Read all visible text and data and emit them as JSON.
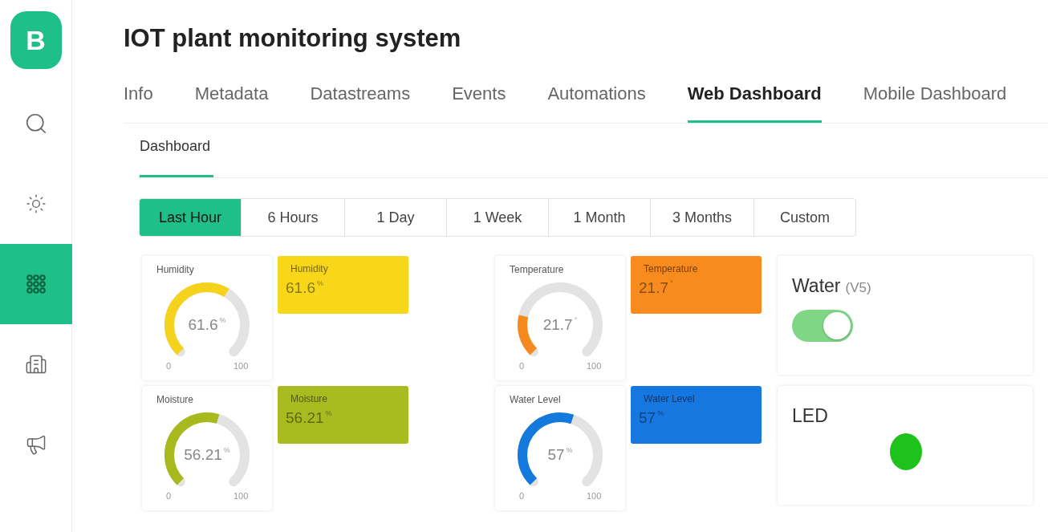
{
  "sidebar": {
    "logo": "B",
    "items": [
      {
        "selected": false
      },
      {
        "selected": false
      },
      {
        "selected": true
      },
      {
        "selected": false
      },
      {
        "selected": false
      }
    ]
  },
  "title": "IOT plant monitoring system",
  "tabs": [
    {
      "label": "Info",
      "selected": false
    },
    {
      "label": "Metadata",
      "selected": false
    },
    {
      "label": "Datastreams",
      "selected": false
    },
    {
      "label": "Events",
      "selected": false
    },
    {
      "label": "Automations",
      "selected": false
    },
    {
      "label": "Web Dashboard",
      "selected": true
    },
    {
      "label": "Mobile Dashboard",
      "selected": false
    }
  ],
  "subtabs": [
    {
      "label": "Dashboard",
      "selected": true
    }
  ],
  "time_ranges": [
    {
      "label": "Last Hour",
      "selected": true
    },
    {
      "label": "6 Hours",
      "selected": false
    },
    {
      "label": "1 Day",
      "selected": false
    },
    {
      "label": "1 Week",
      "selected": false
    },
    {
      "label": "1 Month",
      "selected": false
    },
    {
      "label": "3 Months",
      "selected": false
    },
    {
      "label": "Custom",
      "selected": false
    }
  ],
  "rows": [
    {
      "widgets": [
        {
          "kind": "gauge",
          "title": "Humidity",
          "value": "61.6",
          "unit": "%",
          "color": "#f5d31c",
          "min": "0",
          "max": "100"
        },
        {
          "kind": "value",
          "title": "Humidity",
          "value": "61.6",
          "unit": "%",
          "color": "#f8d61a"
        },
        {
          "kind": "gauge",
          "title": "Temperature",
          "value": "21.7",
          "unit": "°",
          "color": "#f58a1f",
          "min": "0",
          "max": "100"
        },
        {
          "kind": "value",
          "title": "Temperature",
          "value": "21.7",
          "unit": "°",
          "color": "#f78b1e"
        }
      ],
      "side": {
        "kind": "switch",
        "title": "Water",
        "pin": "(V5)",
        "on": true
      }
    },
    {
      "widgets": [
        {
          "kind": "gauge",
          "title": "Moisture",
          "value": "56.21",
          "unit": "%",
          "color": "#a8b91e",
          "min": "0",
          "max": "100"
        },
        {
          "kind": "value",
          "title": "Moisture",
          "value": "56.21",
          "unit": "%",
          "color": "#a9bb1f"
        },
        {
          "kind": "gauge",
          "title": "Water Level",
          "value": "57",
          "unit": "%",
          "color": "#1479dd",
          "min": "0",
          "max": "100"
        },
        {
          "kind": "value",
          "title": "Water Level",
          "value": "57",
          "unit": "%",
          "color": "#1677e0"
        }
      ],
      "side": {
        "kind": "led",
        "title": "LED",
        "color": "#1dc21a"
      }
    }
  ]
}
